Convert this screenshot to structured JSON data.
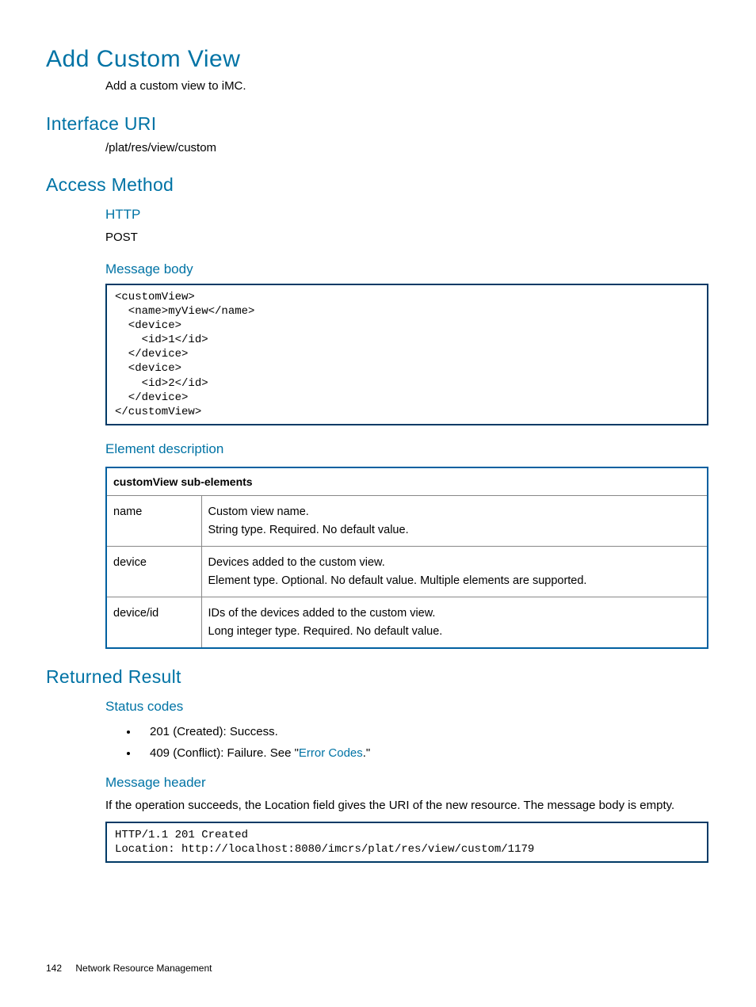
{
  "title": "Add Custom View",
  "intro": "Add a custom view to iMC.",
  "sections": {
    "interface_uri": {
      "heading": "Interface URI",
      "value": "/plat/res/view/custom"
    },
    "access_method": {
      "heading": "Access Method",
      "http_label": "HTTP",
      "http_method": "POST",
      "message_body": {
        "heading": "Message body",
        "code": "<customView>\n  <name>myView</name>\n  <device>\n    <id>1</id>\n  </device>\n  <device>\n    <id>2</id>\n  </device>\n</customView>"
      },
      "element_description": {
        "heading": "Element description",
        "table_header": "customView sub-elements",
        "rows": [
          {
            "name": "name",
            "desc": "Custom view name.\nString type. Required. No default value."
          },
          {
            "name": "device",
            "desc": "Devices added to the custom view.\nElement type. Optional. No default value. Multiple elements are supported."
          },
          {
            "name": "device/id",
            "desc": "IDs of the devices added to the custom view.\nLong integer type. Required. No default value."
          }
        ]
      }
    },
    "returned_result": {
      "heading": "Returned Result",
      "status_codes": {
        "heading": "Status codes",
        "items": [
          {
            "text_pre": "201 (Created): Success.",
            "link": "",
            "text_post": ""
          },
          {
            "text_pre": "409 (Conflict): Failure. See \"",
            "link": "Error Codes",
            "text_post": ".\""
          }
        ]
      },
      "message_header": {
        "heading": "Message header",
        "text": "If the operation succeeds, the Location field gives the URI of the new resource. The message body is empty.",
        "code": "HTTP/1.1 201 Created\nLocation: http://localhost:8080/imcrs/plat/res/view/custom/1179"
      }
    }
  },
  "footer": {
    "page": "142",
    "label": "Network Resource Management"
  }
}
